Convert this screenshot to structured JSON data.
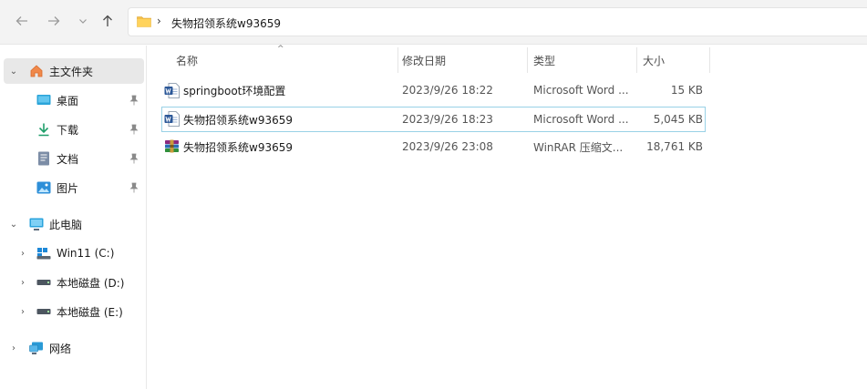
{
  "toolbar": {
    "back_icon": "arrow-left-icon",
    "forward_icon": "arrow-right-icon",
    "recent_icon": "chevron-down-icon",
    "up_icon": "arrow-up-icon"
  },
  "address_bar": {
    "separator": "›",
    "crumb": "失物招领系统w93659"
  },
  "sidebar": {
    "home": "主文件夹",
    "quick_access": [
      {
        "label": "桌面",
        "icon": "desktop-icon"
      },
      {
        "label": "下载",
        "icon": "download-icon"
      },
      {
        "label": "文档",
        "icon": "document-icon"
      },
      {
        "label": "图片",
        "icon": "picture-icon"
      }
    ],
    "this_pc": "此电脑",
    "drives": [
      {
        "label": "Win11 (C:)"
      },
      {
        "label": "本地磁盘 (D:)"
      },
      {
        "label": "本地磁盘 (E:)"
      }
    ],
    "network": "网络"
  },
  "columns": {
    "name": "名称",
    "modified": "修改日期",
    "type": "类型",
    "size": "大小"
  },
  "files": [
    {
      "name": "springboot环境配置",
      "modified": "2023/9/26 18:22",
      "type": "Microsoft Word ...",
      "size": "15 KB",
      "icon": "word-doc-icon"
    },
    {
      "name": "失物招领系统w93659",
      "modified": "2023/9/26 18:23",
      "type": "Microsoft Word ...",
      "size": "5,045 KB",
      "icon": "word-doc-icon"
    },
    {
      "name": "失物招领系统w93659",
      "modified": "2023/9/26 23:08",
      "type": "WinRAR 压缩文...",
      "size": "18,761 KB",
      "icon": "winrar-archive-icon"
    }
  ],
  "colors": {
    "accent": "#0078d4",
    "folder": "#f5c04a",
    "selection_border": "#99d1e6"
  }
}
